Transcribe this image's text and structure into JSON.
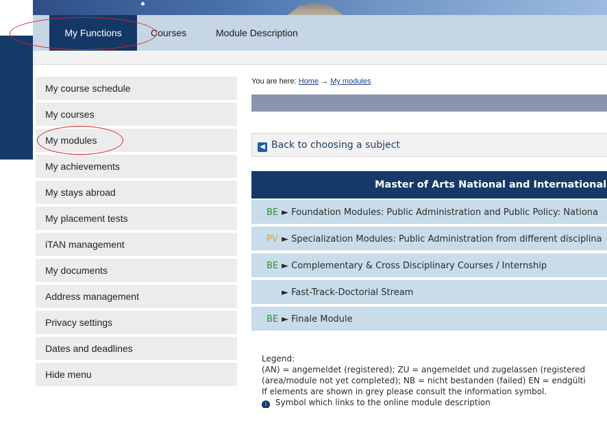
{
  "nav": {
    "items": [
      {
        "label": "My Functions",
        "active": true
      },
      {
        "label": "Courses",
        "active": false
      },
      {
        "label": "Module Description",
        "active": false
      }
    ]
  },
  "sidebar": {
    "items": [
      {
        "label": "My course schedule"
      },
      {
        "label": "My courses"
      },
      {
        "label": "My modules"
      },
      {
        "label": "My achievements"
      },
      {
        "label": "My stays abroad"
      },
      {
        "label": "My placement tests"
      },
      {
        "label": "iTAN management"
      },
      {
        "label": "My documents"
      },
      {
        "label": "Address management"
      },
      {
        "label": "Privacy settings"
      },
      {
        "label": "Dates and deadlines"
      },
      {
        "label": "Hide menu"
      }
    ]
  },
  "breadcrumb": {
    "prefix": "You are here:",
    "home": "Home",
    "arrow": "→",
    "current": "My modules"
  },
  "back_button": {
    "label": "Back to choosing a subject",
    "icon": "back-arrow-icon"
  },
  "program": {
    "title": "Master of Arts National and International"
  },
  "modules": [
    {
      "status": "BE",
      "name": "Foundation Modules: Public Administration and Public Policy: Nationa"
    },
    {
      "status": "PV",
      "name": "Specialization Modules: Public Administration from different disciplina"
    },
    {
      "status": "BE",
      "name": "Complementary & Cross Disciplinary Courses / Internship"
    },
    {
      "status": "",
      "name": "Fast-Track-Doctorial Stream"
    },
    {
      "status": "BE",
      "name": "Finale Module"
    }
  ],
  "expand_marker": "►",
  "legend": {
    "title": "Legend:",
    "line1": "(AN) = angemeldet (registered); ZU = angemeldet und zugelassen (registered",
    "line2": "(area/module not yet completed); NB = nicht bestanden (failed) EN = endgülti",
    "line3": "If elements are shown in grey please consult the information symbol.",
    "symbol": "Symbol which links to the online module description"
  },
  "colors": {
    "primary": "#163a68",
    "nav_bg": "#c7d6e5",
    "row_bg": "#c9dcea",
    "status_be": "#2f8f2f",
    "status_pv": "#e0a030",
    "annotation": "#d8232a"
  }
}
